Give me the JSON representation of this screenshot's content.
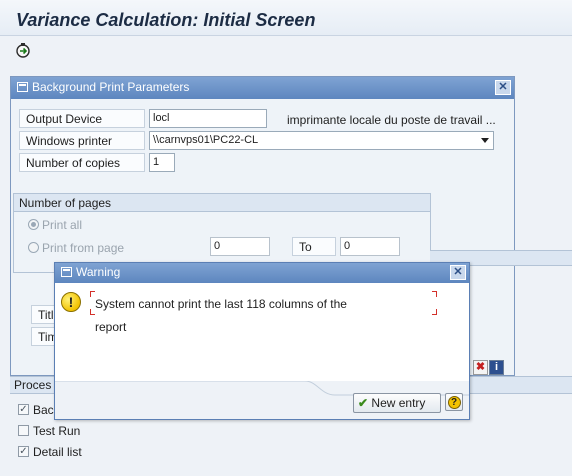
{
  "screen": {
    "title": "Variance Calculation: Initial Screen"
  },
  "print_dialog": {
    "title": "Background Print Parameters",
    "output_device": {
      "label": "Output Device",
      "value": "locl",
      "description": "imprimante locale du poste de travail ..."
    },
    "windows_printer": {
      "label": "Windows printer",
      "value": "\\\\carnvps01\\PC22-CL"
    },
    "copies": {
      "label": "Number of copies",
      "value": "1"
    },
    "pages": {
      "group_title": "Number of pages",
      "print_all": "Print all",
      "print_from": "Print from page",
      "from_value": "0",
      "to_label": "To",
      "to_value": "0"
    },
    "partial_labels": {
      "title": "Titl",
      "time": "Tim"
    }
  },
  "process": {
    "partial_header": "Proces",
    "checkboxes": [
      {
        "label": "Bac",
        "checked": true
      },
      {
        "label": "Test Run",
        "checked": false
      },
      {
        "label": "Detail list",
        "checked": true
      }
    ]
  },
  "warning": {
    "title": "Warning",
    "message_line1": "System cannot print the last 118 columns of the",
    "message_line2": "report",
    "ok_label": "New entry",
    "icon": "exclamation-icon",
    "colors": {
      "titlebar": "#6f96cc",
      "bracket": "#d3302a",
      "ok_check": "#3a8a1c"
    }
  }
}
